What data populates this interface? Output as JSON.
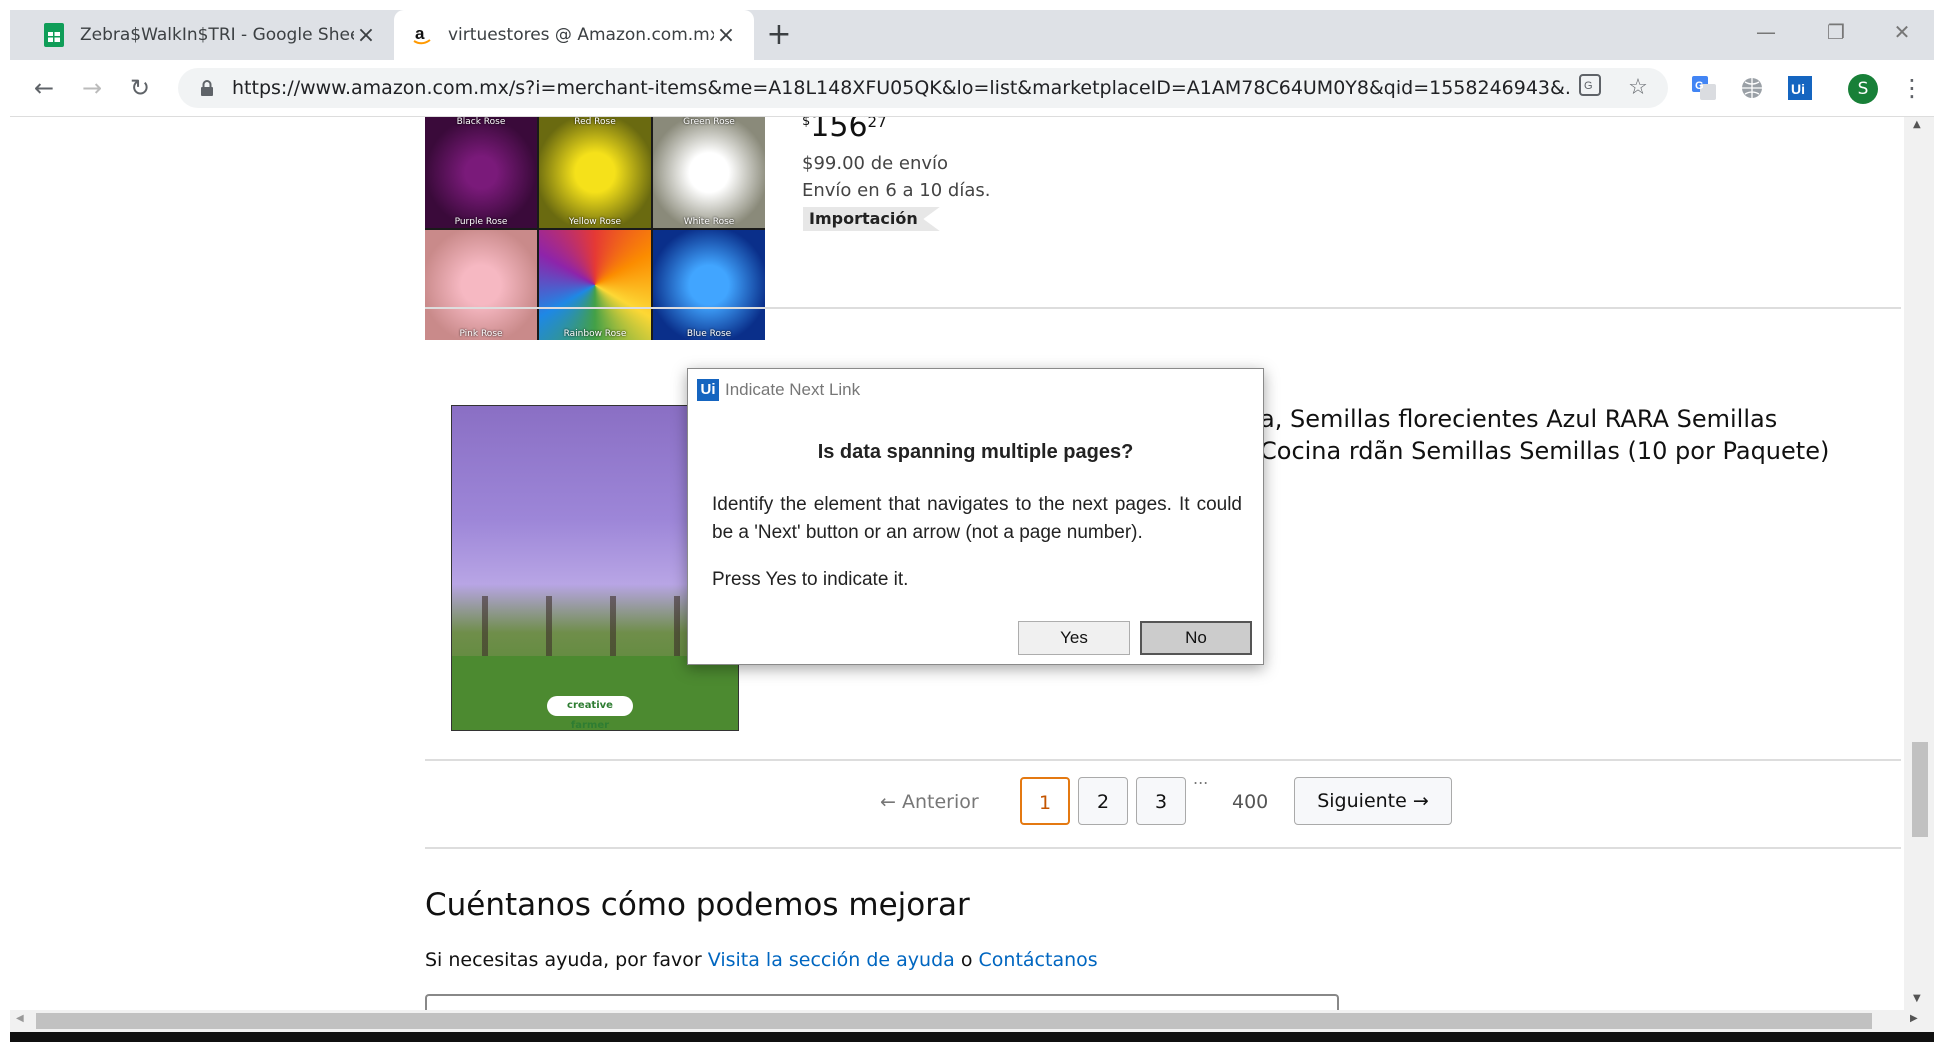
{
  "browser": {
    "tabs": [
      {
        "title": "Zebra$WalkIn$TRI - Google Shee",
        "icon": "google-sheets-icon",
        "active": false
      },
      {
        "title": "virtuestores @ Amazon.com.mx:",
        "icon": "amazon-icon",
        "active": true
      }
    ],
    "new_tab_label": "+",
    "url": "https://www.amazon.com.mx/s?i=merchant-items&me=A18L148XFU05QK&lo=list&marketplaceID=A1AM78C64UM0Y8&qid=1558246943&...",
    "profile_initial": "S",
    "accent_profile_color": "#188038"
  },
  "product1": {
    "image_labels": {
      "top": [
        "Black Rose",
        "Red Rose",
        "Green Rose"
      ],
      "middle": [
        "Purple Rose",
        "Yellow Rose",
        "White Rose"
      ],
      "bottom": [
        "Pink Rose",
        "Rainbow Rose",
        "Blue Rose"
      ]
    },
    "price_currency": "$",
    "price_whole": "156",
    "price_cents": "27",
    "shipping": "$99.00 de envío",
    "delivery": "Envío en 6 a 10 días.",
    "badge": "Importación"
  },
  "product2": {
    "title": "a, Semillas florecientes Azul RARA Semillas Cocina rdãn Semillas Semillas (10 por Paquete)",
    "image_logo": "creative farmer"
  },
  "pagination": {
    "prev_label": "← Anterior",
    "pages": [
      "1",
      "2",
      "3"
    ],
    "current_page": "1",
    "ellipsis": "...",
    "last_page": "400",
    "next_label": "Siguiente →"
  },
  "feedback": {
    "title": "Cuéntanos cómo podemos mejorar",
    "help_prefix": "Si necesitas ayuda, por favor",
    "help_link": "Visita la sección de ayuda",
    "connector": "o",
    "contact_link": "Contáctanos"
  },
  "dialog": {
    "badge": "Ui",
    "title": "Indicate Next Link",
    "question": "Is data spanning multiple pages?",
    "body": "Identify the element that navigates to the next pages. It could be a 'Next' button or an arrow (not a page number).",
    "press": "Press Yes to indicate it.",
    "yes_label": "Yes",
    "no_label": "No"
  }
}
